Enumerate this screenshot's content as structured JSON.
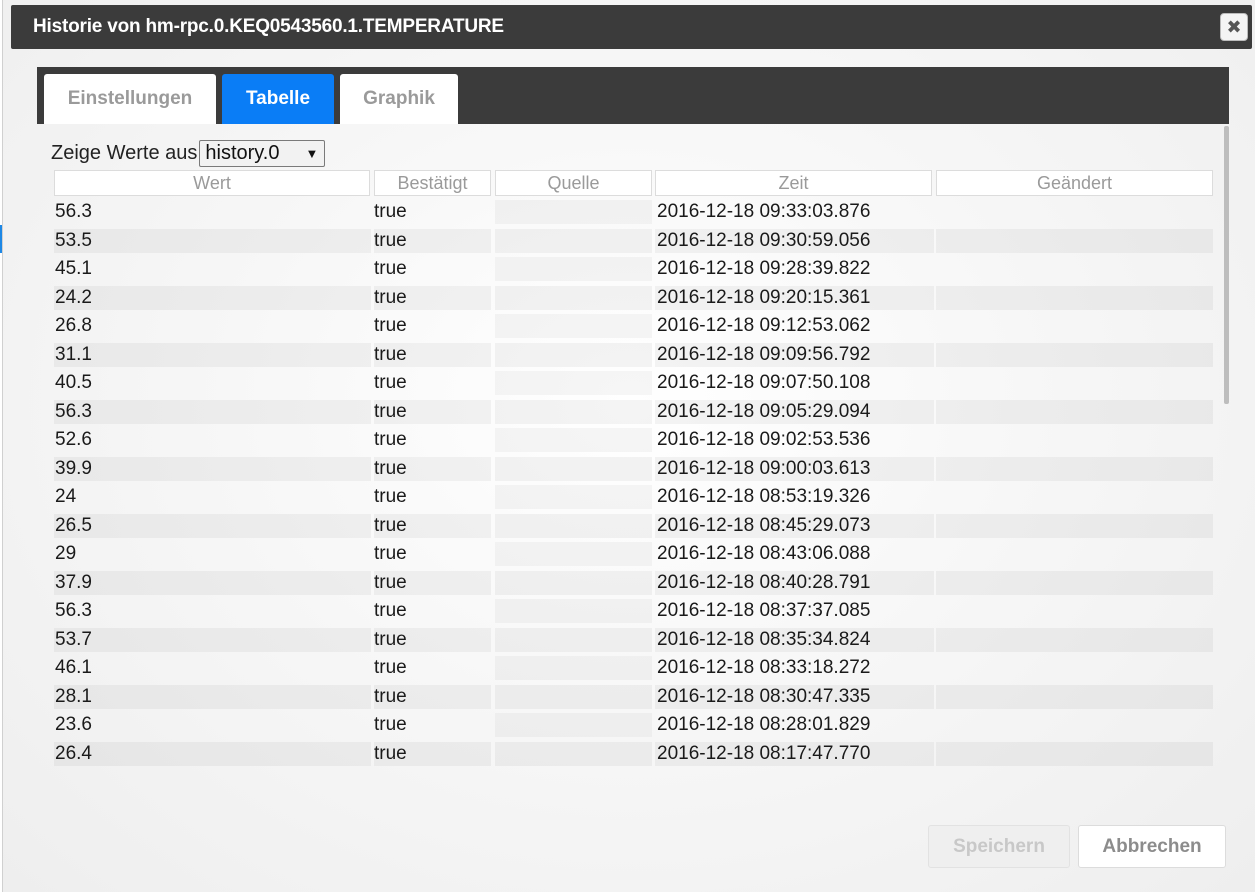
{
  "dialog": {
    "title": "Historie von hm-rpc.0.KEQ0543560.1.TEMPERATURE",
    "close_label": "✖"
  },
  "tabs": [
    {
      "label": "Einstellungen",
      "active": false
    },
    {
      "label": "Tabelle",
      "active": true
    },
    {
      "label": "Graphik",
      "active": false
    }
  ],
  "source": {
    "label": "Zeige Werte aus",
    "selected": "history.0"
  },
  "table": {
    "headers": {
      "wert": "Wert",
      "bestaetigt": "Bestätigt",
      "quelle": "Quelle",
      "zeit": "Zeit",
      "geaendert": "Geändert"
    },
    "rows": [
      {
        "wert": "56.3",
        "bestaetigt": "true",
        "quelle": "",
        "zeit": "2016-12-18 09:33:03.876",
        "geaendert": ""
      },
      {
        "wert": "53.5",
        "bestaetigt": "true",
        "quelle": "",
        "zeit": "2016-12-18 09:30:59.056",
        "geaendert": ""
      },
      {
        "wert": "45.1",
        "bestaetigt": "true",
        "quelle": "",
        "zeit": "2016-12-18 09:28:39.822",
        "geaendert": ""
      },
      {
        "wert": "24.2",
        "bestaetigt": "true",
        "quelle": "",
        "zeit": "2016-12-18 09:20:15.361",
        "geaendert": ""
      },
      {
        "wert": "26.8",
        "bestaetigt": "true",
        "quelle": "",
        "zeit": "2016-12-18 09:12:53.062",
        "geaendert": ""
      },
      {
        "wert": "31.1",
        "bestaetigt": "true",
        "quelle": "",
        "zeit": "2016-12-18 09:09:56.792",
        "geaendert": ""
      },
      {
        "wert": "40.5",
        "bestaetigt": "true",
        "quelle": "",
        "zeit": "2016-12-18 09:07:50.108",
        "geaendert": ""
      },
      {
        "wert": "56.3",
        "bestaetigt": "true",
        "quelle": "",
        "zeit": "2016-12-18 09:05:29.094",
        "geaendert": ""
      },
      {
        "wert": "52.6",
        "bestaetigt": "true",
        "quelle": "",
        "zeit": "2016-12-18 09:02:53.536",
        "geaendert": ""
      },
      {
        "wert": "39.9",
        "bestaetigt": "true",
        "quelle": "",
        "zeit": "2016-12-18 09:00:03.613",
        "geaendert": ""
      },
      {
        "wert": "24",
        "bestaetigt": "true",
        "quelle": "",
        "zeit": "2016-12-18 08:53:19.326",
        "geaendert": ""
      },
      {
        "wert": "26.5",
        "bestaetigt": "true",
        "quelle": "",
        "zeit": "2016-12-18 08:45:29.073",
        "geaendert": ""
      },
      {
        "wert": "29",
        "bestaetigt": "true",
        "quelle": "",
        "zeit": "2016-12-18 08:43:06.088",
        "geaendert": ""
      },
      {
        "wert": "37.9",
        "bestaetigt": "true",
        "quelle": "",
        "zeit": "2016-12-18 08:40:28.791",
        "geaendert": ""
      },
      {
        "wert": "56.3",
        "bestaetigt": "true",
        "quelle": "",
        "zeit": "2016-12-18 08:37:37.085",
        "geaendert": ""
      },
      {
        "wert": "53.7",
        "bestaetigt": "true",
        "quelle": "",
        "zeit": "2016-12-18 08:35:34.824",
        "geaendert": ""
      },
      {
        "wert": "46.1",
        "bestaetigt": "true",
        "quelle": "",
        "zeit": "2016-12-18 08:33:18.272",
        "geaendert": ""
      },
      {
        "wert": "28.1",
        "bestaetigt": "true",
        "quelle": "",
        "zeit": "2016-12-18 08:30:47.335",
        "geaendert": ""
      },
      {
        "wert": "23.6",
        "bestaetigt": "true",
        "quelle": "",
        "zeit": "2016-12-18 08:28:01.829",
        "geaendert": ""
      },
      {
        "wert": "26.4",
        "bestaetigt": "true",
        "quelle": "",
        "zeit": "2016-12-18 08:17:47.770",
        "geaendert": ""
      }
    ]
  },
  "footer": {
    "save_label": "Speichern",
    "cancel_label": "Abbrechen"
  },
  "colors": {
    "titlebar": "#3b3b3b",
    "active_tab": "#0a7df6"
  }
}
